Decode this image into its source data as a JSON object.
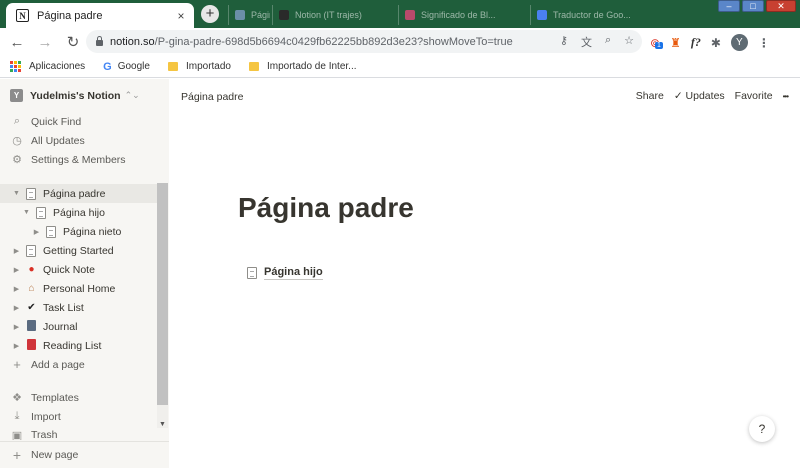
{
  "browser": {
    "active_tab": {
      "title": "Página padre",
      "close": "×"
    },
    "new_tab": "+",
    "background_tabs": [
      {
        "title": "Página",
        "color": "#6b8fa8"
      },
      {
        "title": "Notion (IT trajes)",
        "color": "#2a2a2a"
      },
      {
        "title": "Significado de Bl...",
        "color": "#b84a6b"
      },
      {
        "title": "Traductor de Goo...",
        "color": "#4a80f0"
      }
    ],
    "window_controls": {
      "minimize": "–",
      "maximize": "□",
      "close": "✕"
    },
    "nav": {
      "back": "←",
      "forward": "→",
      "reload": "↻"
    },
    "url": {
      "host": "notion.so",
      "path": "/P-gina-padre-698d5b6694c0429fb62225bb892d3e23?showMoveTo=true"
    },
    "omnibox_icons": [
      "key-icon",
      "translate-icon",
      "zoom-icon",
      "star-icon"
    ],
    "extensions": {
      "badge_count": "1",
      "f_label": "f?",
      "avatar_letter": "Y",
      "menu": "⋮"
    },
    "bookmarks": [
      {
        "label": "Aplicaciones",
        "icon": "apps-icon"
      },
      {
        "label": "Google",
        "icon": "google-icon"
      },
      {
        "label": "Importado",
        "icon": "folder-icon"
      },
      {
        "label": "Importado de Inter...",
        "icon": "folder-icon"
      }
    ]
  },
  "sidebar": {
    "workspace": {
      "badge": "Y",
      "name": "Yudelmis's Notion",
      "caret": "⌃⌄"
    },
    "quick_links": [
      {
        "label": "Quick Find",
        "icon": "search-icon",
        "glyph": "⌕"
      },
      {
        "label": "All Updates",
        "icon": "clock-icon",
        "glyph": "◷"
      },
      {
        "label": "Settings & Members",
        "icon": "gear-icon",
        "glyph": "⚙"
      }
    ],
    "tree": [
      {
        "label": "Página padre",
        "level": 0,
        "expanded": true,
        "selected": true,
        "icon": "page-icon"
      },
      {
        "label": "Página hijo",
        "level": 1,
        "expanded": true,
        "icon": "page-icon"
      },
      {
        "label": "Página nieto",
        "level": 2,
        "expanded": false,
        "icon": "page-icon"
      },
      {
        "label": "Getting Started",
        "level": 0,
        "expanded": false,
        "icon": "page-icon"
      },
      {
        "label": "Quick Note",
        "level": 0,
        "expanded": false,
        "icon": "pin-icon",
        "glyph": "📌"
      },
      {
        "label": "Personal Home",
        "level": 0,
        "expanded": false,
        "icon": "house-icon",
        "glyph": "🏡"
      },
      {
        "label": "Task List",
        "level": 0,
        "expanded": false,
        "icon": "checkmark-icon",
        "glyph": "✔"
      },
      {
        "label": "Journal",
        "level": 0,
        "expanded": false,
        "icon": "notebook-icon",
        "glyph": "📓"
      },
      {
        "label": "Reading List",
        "level": 0,
        "expanded": false,
        "icon": "book-icon",
        "glyph": "📕"
      }
    ],
    "add_page": "Add a page",
    "footer_links": [
      {
        "label": "Templates",
        "icon": "templates-icon",
        "glyph": "❖"
      },
      {
        "label": "Import",
        "icon": "import-icon",
        "glyph": "⤓"
      },
      {
        "label": "Trash",
        "icon": "trash-icon",
        "glyph": "🗑"
      }
    ],
    "new_page": "New page"
  },
  "topbar": {
    "breadcrumb": "Página padre",
    "share": "Share",
    "updates": "Updates",
    "favorite": "Favorite",
    "more": "•••"
  },
  "page": {
    "title": "Página padre",
    "child_page": "Página hijo"
  },
  "help": "?",
  "colors": {
    "tabstrip": "#1f5e3b",
    "sidebar_bg": "#f7f6f3",
    "text": "#37352f",
    "selected_bg": "#e9e8e4"
  }
}
